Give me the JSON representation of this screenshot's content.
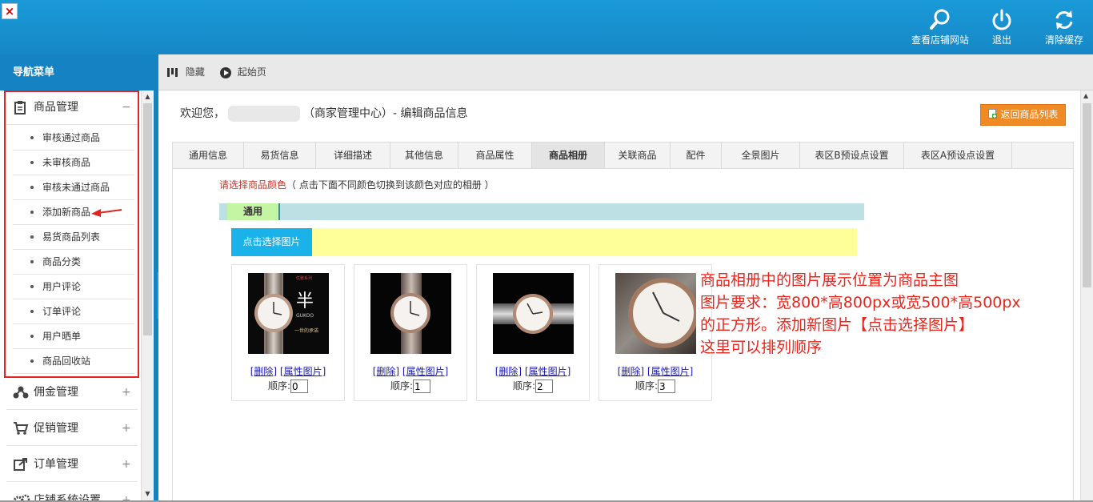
{
  "window": {
    "close_label": "×"
  },
  "header": {
    "buttons": [
      {
        "label": "查看店铺网站",
        "icon": "search-icon"
      },
      {
        "label": "退出",
        "icon": "power-icon"
      },
      {
        "label": "清除缓存",
        "icon": "refresh-icon"
      }
    ]
  },
  "nav": {
    "title": "导航菜单",
    "groups": [
      {
        "label": "商品管理",
        "toggle": "−",
        "icon": "clipboard-icon"
      },
      {
        "label": "佣金管理",
        "toggle": "+",
        "icon": "network-icon"
      },
      {
        "label": "促销管理",
        "toggle": "+",
        "icon": "cart-icon"
      },
      {
        "label": "订单管理",
        "toggle": "+",
        "icon": "share-icon"
      },
      {
        "label": "店铺系统设置",
        "toggle": "+",
        "icon": "gears-icon"
      }
    ],
    "sub_items": [
      "审核通过商品",
      "未审核商品",
      "审核未通过商品",
      "添加新商品",
      "易货商品列表",
      "商品分类",
      "用户评论",
      "订单评论",
      "用户晒单",
      "商品回收站"
    ]
  },
  "toolbar": {
    "hide_label": "隐藏",
    "home_label": "起始页"
  },
  "main": {
    "welcome_prefix": "欢迎您，",
    "welcome_suffix": "（商家管理中心）- 编辑商品信息",
    "back_button": "返回商品列表",
    "tabs": [
      "通用信息",
      "易货信息",
      "详细描述",
      "其他信息",
      "商品属性",
      "商品相册",
      "关联商品",
      "配件",
      "全景图片",
      "表区B预设点设置",
      "表区A预设点设置"
    ],
    "active_tab": "商品相册",
    "color_hint_red": "请选择商品颜色",
    "color_hint_rest": "（ 点击下面不同颜色切换到该颜色对应的相册 ）",
    "color_tag": "通用",
    "upload_button": "点击选择图片",
    "images": [
      {
        "delete": "[删除]",
        "attr": "[属性图片]",
        "order_label": "顺序:",
        "order": "0"
      },
      {
        "delete": "[删除]",
        "attr": "[属性图片]",
        "order_label": "顺序:",
        "order": "1"
      },
      {
        "delete": "[删除]",
        "attr": "[属性图片]",
        "order_label": "顺序:",
        "order": "2"
      },
      {
        "delete": "[删除]",
        "attr": "[属性图片]",
        "order_label": "顺序:",
        "order": "3"
      }
    ],
    "image_text": {
      "brand": "GUKOO",
      "big_char": "半",
      "caption": "一世的承诺",
      "top": "优雅系列"
    },
    "note_lines": [
      "商品相册中的图片展示位置为商品主图",
      "图片要求：宽800*高800px或宽500*高500px",
      "的正方形。添加新图片【点击选择图片】",
      "这里可以排列顺序"
    ]
  },
  "colors": {
    "header_blue": "#1687c6",
    "nav_blue": "#1582c3",
    "accent_orange": "#f08a24",
    "upload_blue": "#19b3ea",
    "annotation_red": "#e8261c"
  }
}
